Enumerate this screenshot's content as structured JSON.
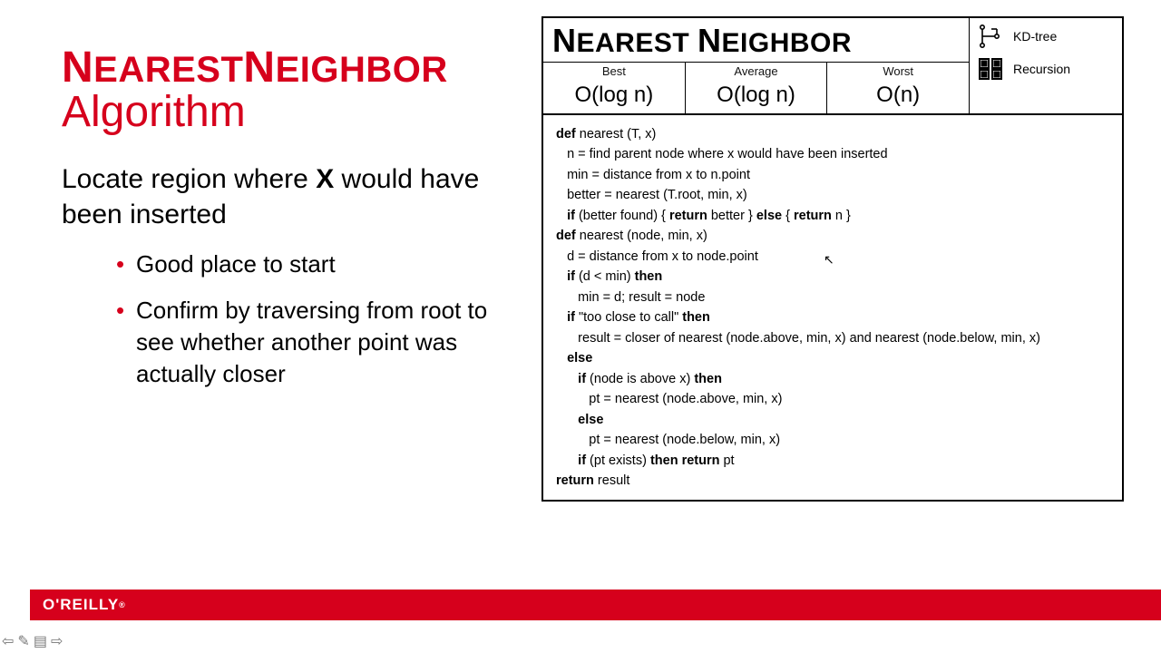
{
  "title": {
    "line1_html": "<span class='lead'>N</span>EAREST<span class='lead'>N</span>EIGHBOR",
    "line2": "Algorithm"
  },
  "subtitle_html": "Locate region where <b>X</b> would have been inserted",
  "bullets": [
    "Good place to start",
    "Confirm by traversing from root to see whether another point was actually closer"
  ],
  "card": {
    "title_html": "<span class='lead'>N</span>EAREST <span class='lead'>N</span>EIGHBOR",
    "complexity": [
      {
        "label": "Best",
        "value": "O(log n)"
      },
      {
        "label": "Average",
        "value": "O(log n)"
      },
      {
        "label": "Worst",
        "value": "O(n)"
      }
    ],
    "side": [
      {
        "icon": "kdtree",
        "label": "KD-tree"
      },
      {
        "icon": "recursion",
        "label": "Recursion"
      }
    ],
    "pseudo": [
      {
        "i": 0,
        "html": "<b>def</b> nearest (T, x)"
      },
      {
        "i": 1,
        "html": "n = find parent node where x would have been inserted"
      },
      {
        "i": 1,
        "html": "min = distance from x to n.point"
      },
      {
        "i": 1,
        "html": "better = nearest (T.root, min, x)"
      },
      {
        "i": 1,
        "html": "<b>if</b> (better found) { <b>return</b> better } <b>else</b> { <b>return</b> n }"
      },
      {
        "i": 0,
        "html": ""
      },
      {
        "i": 0,
        "html": "<b>def</b> nearest (node, min, x)"
      },
      {
        "i": 1,
        "html": "d = distance from x to node.point"
      },
      {
        "i": 1,
        "html": "<b>if</b> (d &lt; min) <b>then</b>"
      },
      {
        "i": 2,
        "html": "min = d; result = node"
      },
      {
        "i": 1,
        "html": "<b>if</b> \"too close to call\" <b>then</b>"
      },
      {
        "i": 2,
        "html": "result = closer of nearest (node.above, min, x) and nearest (node.below, min, x)"
      },
      {
        "i": 1,
        "html": "<b>else</b>"
      },
      {
        "i": 2,
        "html": "<b>if</b> (node is above x) <b>then</b>"
      },
      {
        "i": 3,
        "html": "pt = nearest (node.above, min, x)"
      },
      {
        "i": 2,
        "html": "<b>else</b>"
      },
      {
        "i": 3,
        "html": "pt = nearest (node.below, min, x)"
      },
      {
        "i": 2,
        "html": "<b>if</b> (pt exists) <b>then return</b> pt"
      },
      {
        "i": 0,
        "html": "<b>return</b> result"
      }
    ]
  },
  "brand": "O'REILLY",
  "nav": {
    "prev": "⇦",
    "edit": "✎",
    "menu": "▤",
    "next": "⇨"
  }
}
